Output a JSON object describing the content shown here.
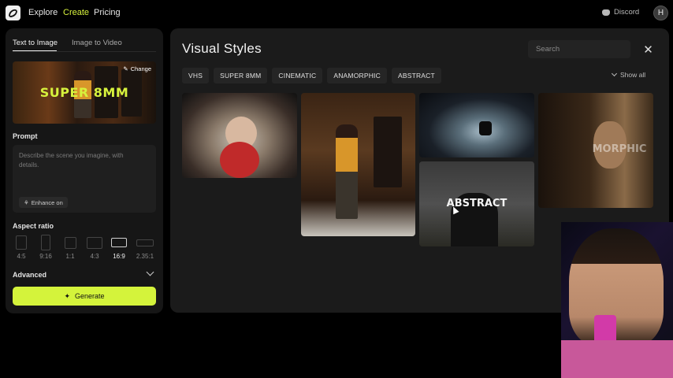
{
  "app": {
    "logo_icon": "app-logo-icon",
    "nav": [
      {
        "label": "Explore",
        "active": false
      },
      {
        "label": "Create",
        "active": true
      },
      {
        "label": "Pricing",
        "active": false
      }
    ],
    "discord_label": "Discord",
    "avatar_initial": "H",
    "accent_color": "#d4f33b"
  },
  "left_panel": {
    "tabs": [
      {
        "label": "Text to Image",
        "active": true
      },
      {
        "label": "Image to Video",
        "active": false
      }
    ],
    "selected_style": {
      "label": "SUPER 8MM",
      "change_label": "Change"
    },
    "prompt": {
      "title": "Prompt",
      "placeholder": "Describe the scene you imagine, with details.",
      "enhance_label": "Enhance on"
    },
    "aspect_ratio": {
      "title": "Aspect ratio",
      "options": [
        "4:5",
        "9:16",
        "1:1",
        "4:3",
        "16:9",
        "2.35:1"
      ],
      "selected": "16:9"
    },
    "advanced_label": "Advanced",
    "generate_label": "Generate"
  },
  "main_panel": {
    "title": "Visual Styles",
    "search_placeholder": "Search",
    "close_icon": "close-icon",
    "chips": [
      "VHS",
      "SUPER 8MM",
      "CINEMATIC",
      "ANAMORPHIC",
      "ABSTRACT"
    ],
    "show_all_label": "Show all",
    "cards": [
      {
        "name": "fisheye-skater",
        "label": ""
      },
      {
        "name": "room-yellow-jacket",
        "label": ""
      },
      {
        "name": "motorbike-tunnel",
        "label": ""
      },
      {
        "name": "abstract-silhouette",
        "label": "ABSTRACT"
      },
      {
        "name": "anamorphic-portrait",
        "label": "MORPHIC"
      }
    ]
  }
}
